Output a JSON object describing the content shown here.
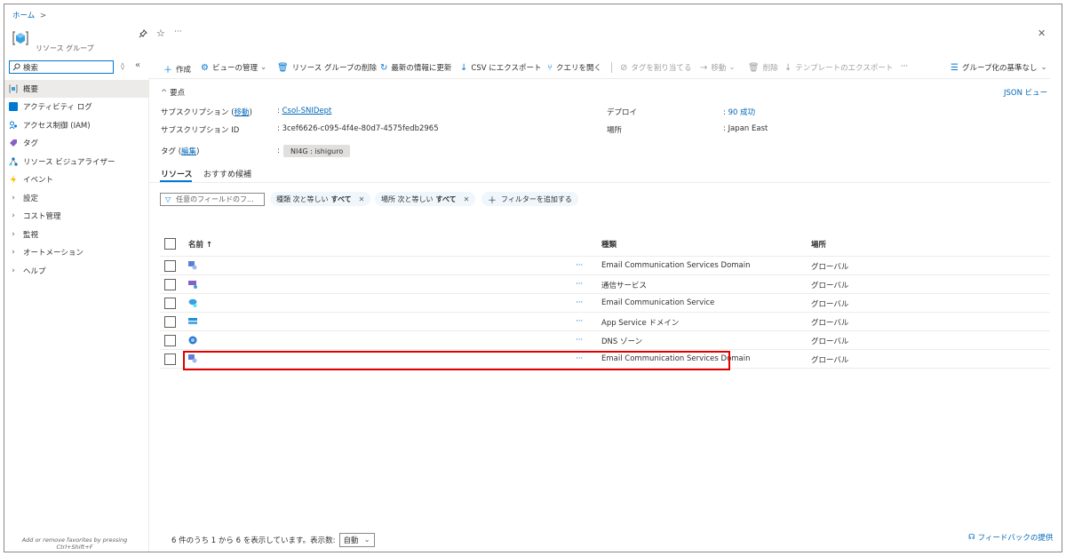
{
  "breadcrumb": {
    "home": "ホーム",
    "sep": ">"
  },
  "resource": {
    "type_label": "リソース グループ"
  },
  "header_icons": {
    "pin": "pin-icon",
    "star": "star-icon",
    "more": "···",
    "close": "✕"
  },
  "search": {
    "placeholder": "検索",
    "collapse": "«",
    "toggle": "◊"
  },
  "sidebar": {
    "items": [
      {
        "label": "概要",
        "icon": "overview-icon",
        "selected": true
      },
      {
        "label": "アクティビティ ログ",
        "icon": "activity-log-icon"
      },
      {
        "label": "アクセス制御 (IAM)",
        "icon": "iam-icon"
      },
      {
        "label": "タグ",
        "icon": "tag-icon"
      },
      {
        "label": "リソース ビジュアライザー",
        "icon": "visualizer-icon"
      },
      {
        "label": "イベント",
        "icon": "event-icon"
      },
      {
        "label": "設定",
        "icon": "chevron-right-icon"
      },
      {
        "label": "コスト管理",
        "icon": "chevron-right-icon"
      },
      {
        "label": "監視",
        "icon": "chevron-right-icon"
      },
      {
        "label": "オートメーション",
        "icon": "chevron-right-icon"
      },
      {
        "label": "ヘルプ",
        "icon": "chevron-right-icon"
      }
    ],
    "favorites_hint_1": "Add or remove favorites by pressing",
    "favorites_hint_2": "Ctrl+Shift+F"
  },
  "toolbar": {
    "create": "作成",
    "manage_view": "ビューの管理",
    "delete_rg": "リソース グループの削除",
    "refresh": "最新の情報に更新",
    "export_csv": "CSV にエクスポート",
    "open_query": "クエリを開く",
    "assign_tags": "タグを割り当てる",
    "move": "移動",
    "delete": "削除",
    "export_template": "テンプレートのエクスポート",
    "more": "···",
    "group_by": "グループ化の基準なし"
  },
  "essentials": {
    "toggle": "要点",
    "json_view": "JSON ビュー",
    "subscription_label": "サブスクリプション",
    "move_link": "移動",
    "subscription_value": "Csol-SNIDept",
    "subscription_id_label": "サブスクリプション ID",
    "subscription_id_value": "3cef6626-c095-4f4e-80d7-4575fedb2965",
    "deploy_label": "デプロイ",
    "deploy_value": "90 成功",
    "location_label": "場所",
    "location_value": "Japan East",
    "tags_label": "タグ",
    "edit_link": "編集",
    "tag_value": "NI4G : ishiguro"
  },
  "tabs": {
    "resources": "リソース",
    "recommendations": "おすすめ候補"
  },
  "filters": {
    "placeholder": "任意のフィールドのフ...",
    "type_filter_prefix": "種類 次と等しい",
    "type_filter_value": "すべて",
    "location_filter_prefix": "場所 次と等しい",
    "location_filter_value": "すべて",
    "add_filter": "フィルターを追加する"
  },
  "table": {
    "headers": {
      "name": "名前 ↑",
      "type": "種類",
      "location": "場所"
    },
    "rows": [
      {
        "type": "Email Communication Services Domain",
        "location": "グローバル",
        "icon": "email-domain-icon",
        "color": "#5c7fd6"
      },
      {
        "type": "通信サービス",
        "location": "グローバル",
        "icon": "communication-service-icon",
        "color": "#8661c5"
      },
      {
        "type": "Email Communication Service",
        "location": "グローバル",
        "icon": "email-service-icon",
        "color": "#3aa0e0"
      },
      {
        "type": "App Service ドメイン",
        "location": "グローバル",
        "icon": "app-service-domain-icon",
        "color": "#1e90d6"
      },
      {
        "type": "DNS ゾーン",
        "location": "グローバル",
        "icon": "dns-zone-icon",
        "color": "#2d7ad6"
      },
      {
        "type": "Email Communication Services Domain",
        "location": "グローバル",
        "icon": "email-domain-icon",
        "color": "#5c7fd6",
        "highlighted": true
      }
    ],
    "row_more": "···"
  },
  "footer": {
    "summary": "6 件のうち 1 から 6 を表示しています。表示数:",
    "page_size": "自動",
    "feedback": "フィードバックの提供"
  },
  "colors": {
    "accent": "#0078d4",
    "highlight": "#e00000",
    "selected_bg": "#edebe9"
  }
}
